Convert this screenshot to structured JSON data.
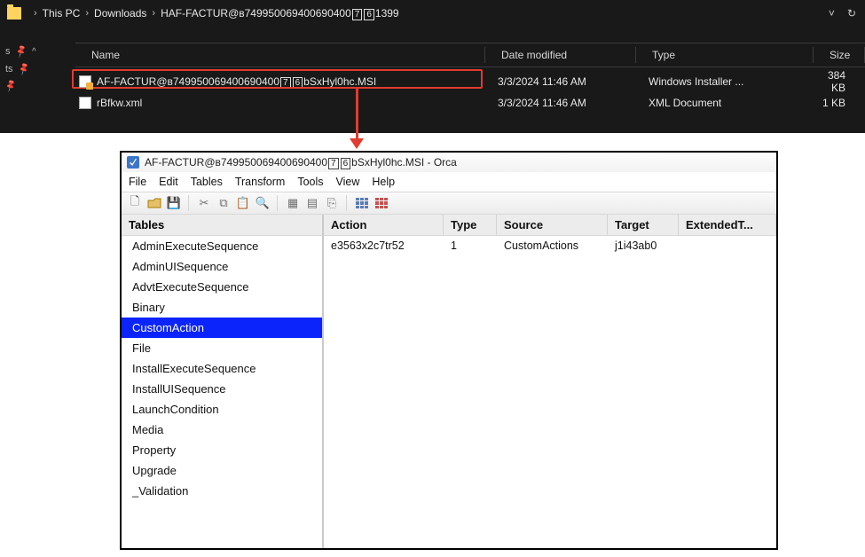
{
  "breadcrumbs": {
    "pc": "This PC",
    "downloads": "Downloads",
    "folder_prefix": "HAF-FACTUR@в749950069400690400",
    "folder_box1": "7",
    "folder_box2": "6",
    "folder_suffix": "1399"
  },
  "sidebar": {
    "row1": "s",
    "row2": "ts"
  },
  "columns": {
    "name": "Name",
    "date": "Date modified",
    "type": "Type",
    "size": "Size"
  },
  "files": [
    {
      "name_prefix": "AF-FACTUR@в749950069400690400",
      "name_box1": "7",
      "name_box2": "6",
      "name_suffix": "bSxHyl0hc.MSI",
      "date": "3/3/2024 11:46 AM",
      "type": "Windows Installer ...",
      "size": "384 KB",
      "icon": "msi"
    },
    {
      "name_prefix": "rBfkw.xml",
      "name_box1": "",
      "name_box2": "",
      "name_suffix": "",
      "date": "3/3/2024 11:46 AM",
      "type": "XML Document",
      "size": "1 KB",
      "icon": "xml"
    }
  ],
  "orca": {
    "title_prefix": "AF-FACTUR@в749950069400690400",
    "title_box1": "7",
    "title_box2": "6",
    "title_suffix": "bSxHyl0hc.MSI - Orca",
    "menu": {
      "file": "File",
      "edit": "Edit",
      "tables": "Tables",
      "transform": "Transform",
      "tools": "Tools",
      "view": "View",
      "help": "Help"
    },
    "tables_header": "Tables",
    "tables": [
      "AdminExecuteSequence",
      "AdminUISequence",
      "AdvtExecuteSequence",
      "Binary",
      "CustomAction",
      "File",
      "InstallExecuteSequence",
      "InstallUISequence",
      "LaunchCondition",
      "Media",
      "Property",
      "Upgrade",
      "_Validation"
    ],
    "selected_table_index": 4,
    "grid_headers": {
      "action": "Action",
      "type": "Type",
      "source": "Source",
      "target": "Target",
      "ext": "ExtendedT..."
    },
    "grid_rows": [
      {
        "action": "e3563x2c7tr52",
        "type": "1",
        "source": "CustomActions",
        "target": "j1i43ab0",
        "ext": ""
      }
    ]
  }
}
